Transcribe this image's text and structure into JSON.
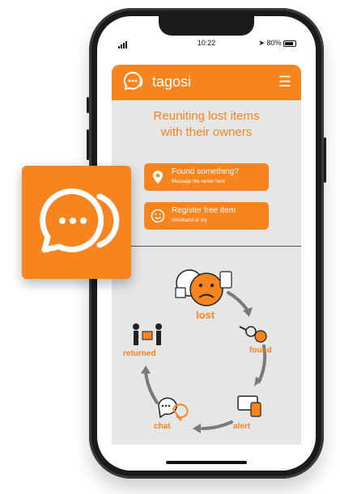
{
  "status_bar": {
    "time": "10:22",
    "battery": "80%"
  },
  "app": {
    "name": "tagosi"
  },
  "hero": {
    "line1": "Reuniting lost items",
    "line2": "with their owners"
  },
  "actions": [
    {
      "title": "Found something?",
      "subtitle": "Message the owner here"
    },
    {
      "title": "Register free item",
      "subtitle": "Wristband or toy"
    }
  ],
  "cycle": {
    "steps": [
      "lost",
      "found",
      "alert",
      "chat",
      "returned"
    ]
  },
  "colors": {
    "accent": "#f7841e",
    "background": "#e6e6e6"
  },
  "icons": [
    "menu-icon",
    "location-pin-icon",
    "smiley-icon",
    "chat-bubble-icon"
  ]
}
